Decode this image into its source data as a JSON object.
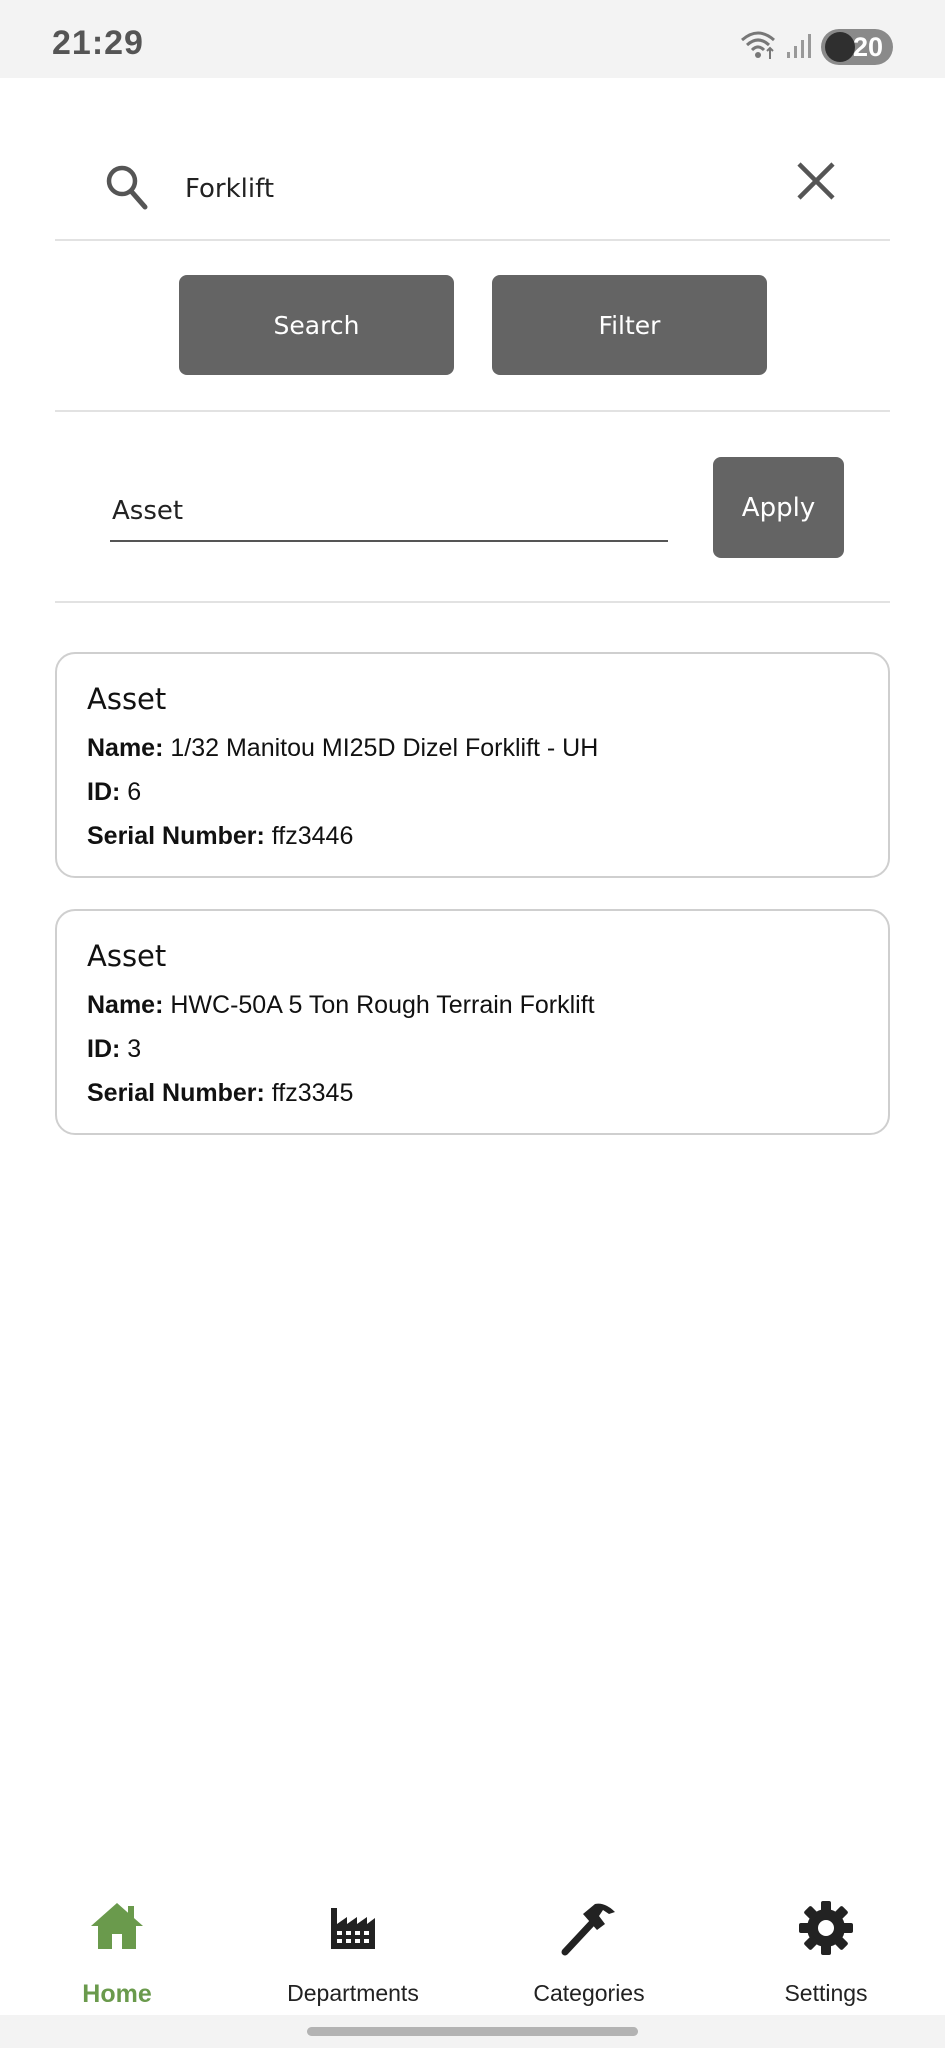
{
  "status_bar": {
    "time": "21:29",
    "battery_level": "20"
  },
  "search": {
    "query": "Forklift",
    "search_button": "Search",
    "filter_button": "Filter"
  },
  "filter": {
    "value": "Asset",
    "apply_button": "Apply"
  },
  "results": [
    {
      "title": "Asset",
      "name_label": "Name:",
      "name": "1/32 Manitou MI25D Dizel Forklift - UH",
      "id_label": "ID:",
      "id": "6",
      "serial_label": "Serial Number:",
      "serial": "ffz3446"
    },
    {
      "title": "Asset",
      "name_label": "Name:",
      "name": "HWC-50A 5 Ton Rough Terrain Forklift",
      "id_label": "ID:",
      "id": "3",
      "serial_label": "Serial Number:",
      "serial": "ffz3345"
    }
  ],
  "nav": {
    "active_color": "#6a9a4c",
    "items": [
      {
        "label": "Home",
        "icon": "home-icon",
        "active": true
      },
      {
        "label": "Departments",
        "icon": "factory-icon",
        "active": false
      },
      {
        "label": "Categories",
        "icon": "hammer-icon",
        "active": false
      },
      {
        "label": "Settings",
        "icon": "gear-icon",
        "active": false
      }
    ]
  }
}
